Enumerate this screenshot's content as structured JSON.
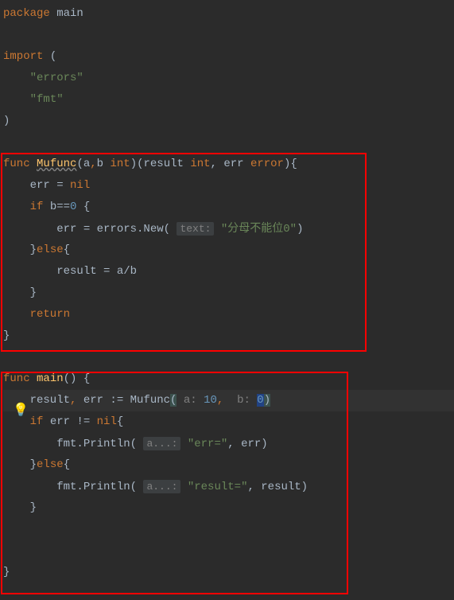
{
  "code": {
    "l1_kw": "package",
    "l1_pkg": "main",
    "l2": "",
    "l3_kw": "import",
    "l3_paren": "(",
    "l4_str": "\"errors\"",
    "l5_str": "\"fmt\"",
    "l6_paren": ")",
    "l7": "",
    "l8_kw": "func",
    "l8_name": "Mufunc",
    "l8_sig1": "(a",
    "l8_comma1": ",",
    "l8_sig2": "b ",
    "l8_type1": "int",
    "l8_sig3": ")(result ",
    "l8_type2": "int",
    "l8_sig4": ", err ",
    "l8_type3": "error",
    "l8_sig5": "){",
    "l9_lhs": "    err = ",
    "l9_nil": "nil",
    "l10_if": "    if",
    "l10_cond": " b==",
    "l10_zero": "0",
    "l10_brace": " {",
    "l11_pre": "        err = errors.New( ",
    "l11_hint": "text:",
    "l11_str": " \"分母不能位0\"",
    "l11_end": ")",
    "l12_close": "    }",
    "l12_else": "else",
    "l12_open": "{",
    "l13": "        result = a/b",
    "l14": "    }",
    "l15_kw": "    return",
    "l16": "}",
    "l17": "",
    "l18_kw": "func",
    "l18_name": " main",
    "l18_sig": "() {",
    "l19_pre": "    result",
    "l19_comma": ", ",
    "l19_err": "err := Mufunc",
    "l19_paren1": "(",
    "l19_hint1": " a: ",
    "l19_v1": "10",
    "l19_c": ",",
    "l19_hint2": "  b: ",
    "l19_v2": "0",
    "l19_paren2": ")",
    "l20_if": "    if",
    "l20_cond": " err != ",
    "l20_nil": "nil",
    "l20_brace": "{",
    "l21_pre": "        fmt.Println( ",
    "l21_hint": "a...:",
    "l21_str": " \"err=\"",
    "l21_rest": ", err)",
    "l22_close": "    }",
    "l22_else": "else",
    "l22_open": "{",
    "l23_pre": "        fmt.Println( ",
    "l23_hint": "a...:",
    "l23_str": " \"result=\"",
    "l23_rest": ", result)",
    "l24": "    }",
    "l25": "",
    "l26": "",
    "l27": "}"
  },
  "bulb": "💡"
}
